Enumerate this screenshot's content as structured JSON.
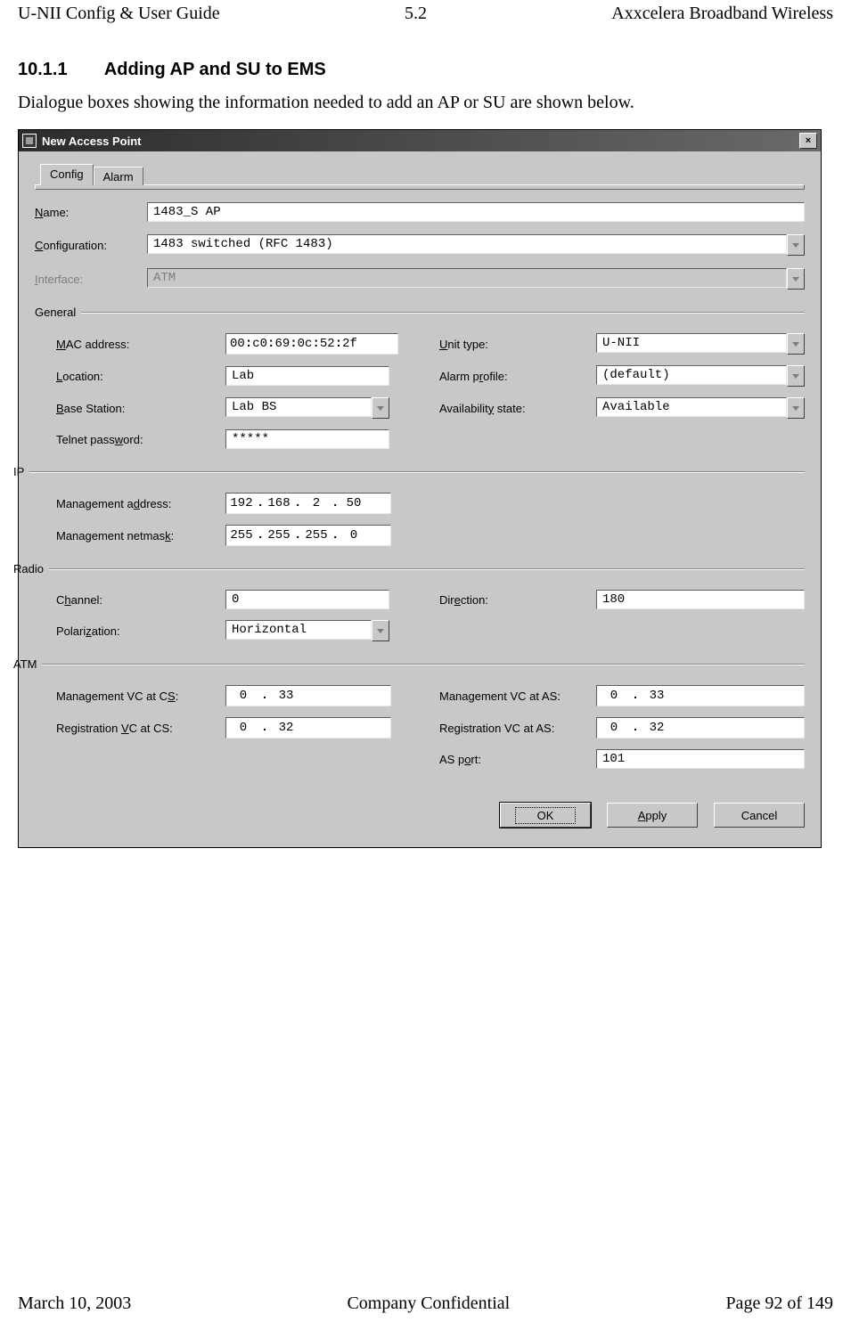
{
  "page_header": {
    "left": "U-NII Config & User Guide",
    "center": "5.2",
    "right": "Axxcelera Broadband Wireless"
  },
  "section": {
    "number": "10.1.1",
    "title": "Adding AP and SU to EMS"
  },
  "body_text": "Dialogue boxes showing the information needed to add an AP or SU are shown below.",
  "page_footer": {
    "left": "March 10, 2003",
    "center": "Company Confidential",
    "right": "Page 92 of 149"
  },
  "dialog": {
    "title": "New Access Point",
    "tabs": {
      "config": "Config",
      "alarm": "Alarm"
    },
    "top": {
      "name_label": "Name:",
      "name_value": "1483_S AP",
      "config_label": "Configuration:",
      "config_value": "1483 switched (RFC 1483)",
      "iface_label": "Interface:",
      "iface_value": "ATM"
    },
    "general": {
      "legend": "General",
      "mac_label": "MAC address:",
      "mac": [
        "00",
        "c0",
        "69",
        "0c",
        "52",
        "2f"
      ],
      "location_label": "Location:",
      "location_value": "Lab",
      "base_label": "Base Station:",
      "base_value": "Lab BS",
      "telnet_label": "Telnet password:",
      "telnet_value": "*****",
      "unit_label": "Unit type:",
      "unit_value": "U-NII",
      "alarmp_label": "Alarm profile:",
      "alarmp_value": "(default)",
      "avail_label": "Availability state:",
      "avail_value": "Available"
    },
    "ip": {
      "legend": "IP",
      "addr_label": "Management address:",
      "addr": [
        "192",
        "168",
        "2",
        "50"
      ],
      "mask_label": "Management netmask:",
      "mask": [
        "255",
        "255",
        "255",
        "0"
      ]
    },
    "radio": {
      "legend": "Radio",
      "channel_label": "Channel:",
      "channel_value": "0",
      "polar_label": "Polarization:",
      "polar_value": "Horizontal",
      "dir_label": "Direction:",
      "dir_value": "180"
    },
    "atm": {
      "legend": "ATM",
      "mvc_cs_label": "Management VC at CS:",
      "mvc_cs": [
        "0",
        "33"
      ],
      "rvc_cs_label": "Registration VC at CS:",
      "rvc_cs": [
        "0",
        "32"
      ],
      "mvc_as_label": "Management VC at AS:",
      "mvc_as": [
        "0",
        "33"
      ],
      "rvc_as_label": "Registration VC at AS:",
      "rvc_as": [
        "0",
        "32"
      ],
      "asport_label": "AS port:",
      "asport_value": "101"
    },
    "buttons": {
      "ok": "OK",
      "apply": "Apply",
      "cancel": "Cancel"
    }
  }
}
